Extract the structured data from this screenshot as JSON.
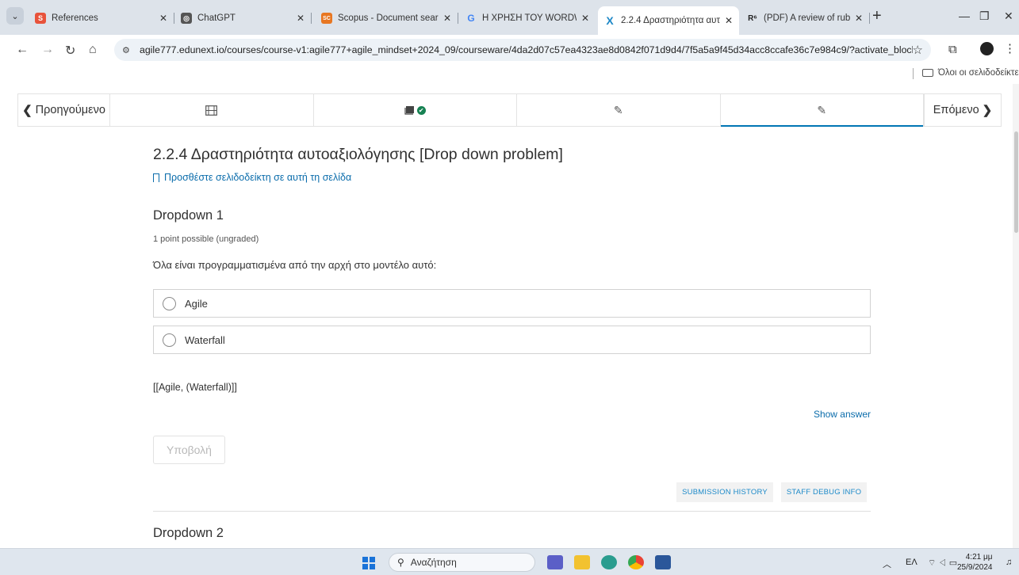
{
  "browser": {
    "tabs": [
      {
        "title": "References",
        "favicon_color": "#e8533b",
        "favicon_text": "S"
      },
      {
        "title": "ChatGPT",
        "favicon_color": "#555555",
        "favicon_text": "◎"
      },
      {
        "title": "Scopus - Document search",
        "favicon_color": "#e87722",
        "favicon_text": "SC"
      },
      {
        "title": "Η ΧΡΗΣΗ ΤΟΥ WORDWALL",
        "favicon_color": "#ffffff",
        "favicon_text": "G"
      },
      {
        "title": "2.2.4 Δραστηριότητα αυτο",
        "favicon_color": "#ffffff",
        "favicon_text": "X"
      },
      {
        "title": "(PDF) A review of rubric us",
        "favicon_color": "#ffffff",
        "favicon_text": "R⁶"
      }
    ],
    "new_tab": "+",
    "address": {
      "url": "agile777.edunext.io/courses/course-v1:agile777+agile_mindset+2024_09/courseware/4da2d07c57ea4323ae8d0842f071d9d4/7f5a5a9f45d34acc8ccafe36c7e984c9/?activate_block_id=bloc..."
    },
    "bookmarks_bar": {
      "all_bookmarks": "Όλοι οι σελιδοδείκτες"
    }
  },
  "sequence_nav": {
    "previous": "Προηγούμενο",
    "next": "Επόμενο"
  },
  "unit": {
    "title": "2.2.4 Δραστηριότητα αυτοαξιολόγησης [Drop down problem]",
    "bookmark_link": "Προσθέστε σελιδοδείκτη σε αυτή τη σελίδα"
  },
  "problem1": {
    "title": "Dropdown 1",
    "meta": "1 point possible (ungraded)",
    "question": "Όλα είναι προγραμματισμένα από την αρχή στο μοντέλο αυτό:",
    "choices": [
      "Agile",
      "Waterfall"
    ],
    "answer_text": "[[Agile, (Waterfall)]]",
    "show_answer": "Show answer",
    "submit": "Υποβολή",
    "submission_history": "SUBMISSION HISTORY",
    "staff_debug": "STAFF DEBUG INFO"
  },
  "problem2": {
    "title": "Dropdown 2"
  },
  "taskbar": {
    "search": "Αναζήτηση",
    "language": "ΕΛ",
    "time": "4:21 μμ",
    "date": "25/9/2024"
  },
  "colors": {
    "link": "#0a6cab",
    "active_tab_underline": "#0075b4",
    "success": "#178253"
  }
}
